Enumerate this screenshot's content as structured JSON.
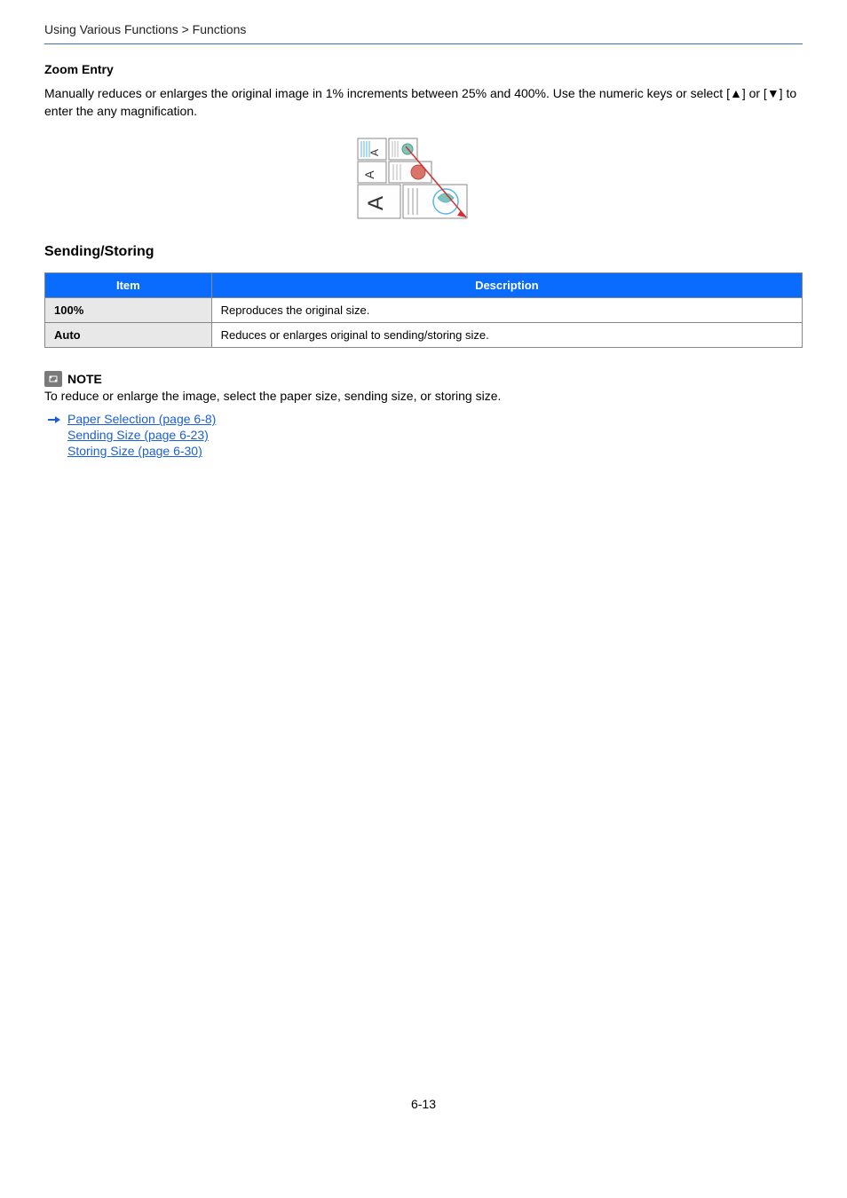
{
  "breadcrumb": "Using Various Functions > Functions",
  "zoom_entry": {
    "title": "Zoom Entry",
    "paragraph": "Manually reduces or enlarges the original image in 1% increments between 25% and 400%. Use the numeric keys or select [▲] or [▼] to enter the any magnification."
  },
  "sending_storing": {
    "title": "Sending/Storing",
    "headers": {
      "item": "Item",
      "description": "Description"
    },
    "rows": [
      {
        "item": "100%",
        "description": "Reproduces the original size."
      },
      {
        "item": "Auto",
        "description": "Reduces or enlarges original to sending/storing size."
      }
    ]
  },
  "note": {
    "label": "NOTE",
    "text": "To reduce or enlarge the image, select the paper size, sending size, or storing size.",
    "links": [
      "Paper Selection (page 6-8)",
      "Sending Size (page 6-23)",
      "Storing Size (page 6-30)"
    ]
  },
  "page_number": "6-13"
}
